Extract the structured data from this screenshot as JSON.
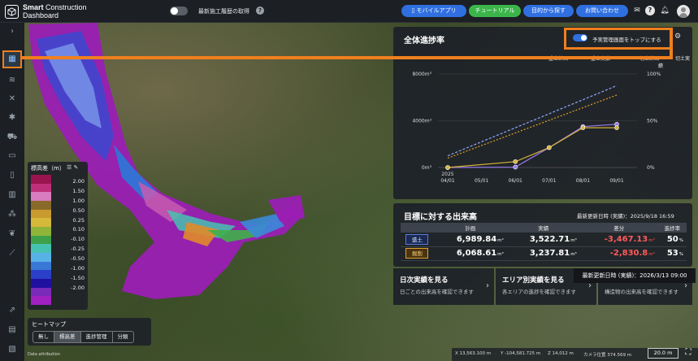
{
  "app": {
    "title_line1_bold": "Smart",
    "title_line1": " Construction",
    "title_line2": "Dashboard"
  },
  "topbar": {
    "history_label": "最新施工履歴の取得",
    "mobile_app": "モバイルアプリ",
    "tutorial": "チュートリアル",
    "find_by_purpose": "目的から探す",
    "contact": "お問い合わせ"
  },
  "legend": {
    "title": "標高差（m）",
    "colors": [
      "#9a1450",
      "#c0307a",
      "#d97cc0",
      "#8a6a2a",
      "#c89a30",
      "#d6b83a",
      "#8fb43a",
      "#3fa04a",
      "#46c2b0",
      "#58b2e8",
      "#3a78d8",
      "#2a40c8",
      "#2010a0",
      "#7a2ab8",
      "#a020c0"
    ],
    "labels": [
      "2.00",
      "1.50",
      "1.00",
      "0.50",
      "0.25",
      "0.10",
      "-0.10",
      "-0.25",
      "-0.50",
      "-1.00",
      "-1.50",
      "-2.00"
    ]
  },
  "heatmap": {
    "title": "ヒートマップ",
    "modes": [
      "無し",
      "標高差",
      "進捗管理",
      "分類"
    ],
    "selected": "標高差"
  },
  "data_attribution": "Data attribution",
  "status": {
    "x": "X 13,563.100 m",
    "y": "Y -104,581.725 m",
    "z": "Z 14,012 m",
    "camera": "カメラ位置 374.569 m",
    "scale": "20.0 m"
  },
  "progress": {
    "title": "全体進捗率",
    "toggle_label": "予実管理画面をトップにする",
    "legend": [
      {
        "name": "盛土計画",
        "color": "#8fa8ff",
        "dash": "3,2"
      },
      {
        "name": "盛土実績",
        "color": "#9a7cf0",
        "dash": ""
      },
      {
        "name": "切土計画",
        "color": "#e0a02a",
        "dash": "2,2"
      },
      {
        "name": "切土実績",
        "color": "#d6b23a",
        "dash": ""
      }
    ]
  },
  "chart_data": {
    "type": "line",
    "x": [
      "2025 04/01",
      "05/01",
      "06/01",
      "07/01",
      "08/01",
      "09/01"
    ],
    "y_left_ticks": [
      "0m³",
      "4000m³",
      "8000m³"
    ],
    "y_right_ticks": [
      "0%",
      "50%",
      "100%"
    ],
    "ylim": [
      0,
      8000
    ],
    "series": [
      {
        "name": "盛土計画",
        "x_index": [
          0,
          5
        ],
        "values": [
          1000,
          7000
        ]
      },
      {
        "name": "切土計画",
        "x_index": [
          0,
          5
        ],
        "values": [
          800,
          6200
        ]
      },
      {
        "name": "盛土実績",
        "x_index": [
          0,
          2,
          3,
          4,
          5
        ],
        "values": [
          0,
          30,
          1700,
          3500,
          3700
        ]
      },
      {
        "name": "切土実績",
        "x_index": [
          0,
          2,
          3,
          4,
          5
        ],
        "values": [
          0,
          500,
          1700,
          3400,
          3400
        ]
      }
    ]
  },
  "output": {
    "title": "目標に対する出来高",
    "updated": "最新更新日時 (実績)：2025/9/18 16:59",
    "headers": [
      "",
      "計画",
      "実績",
      "差分",
      "進捗率"
    ],
    "rows": [
      {
        "cat": "盛土",
        "type": "fill",
        "plan": "6,989.84",
        "actual": "3,522.71",
        "diff": "-3,467.13",
        "rate": "50"
      },
      {
        "cat": "掘削",
        "type": "cut",
        "plan": "6,068.61",
        "actual": "3,237.81",
        "diff": "-2,830.8",
        "rate": "53"
      }
    ],
    "unit": "m³",
    "pct": "%"
  },
  "cards": [
    {
      "title": "日次実績を見る",
      "sub": "日ごとの出来高を確認できます"
    },
    {
      "title": "エリア別実績を見る",
      "sub": "各エリアの進捗を確認できます"
    },
    {
      "title": "",
      "sub": "構造物の出来高を確認できます"
    }
  ],
  "tooltip": "最新更新日時 (実績)：2026/3/13 09:00"
}
